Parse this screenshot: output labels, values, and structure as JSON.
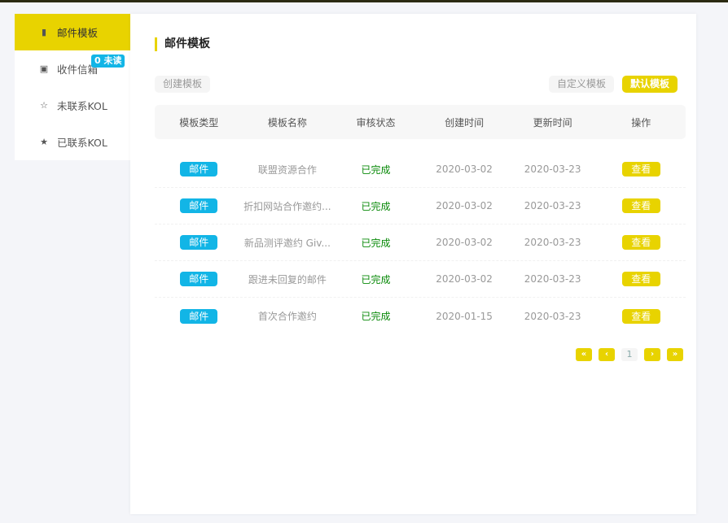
{
  "sidebar": {
    "items": [
      {
        "label": "邮件模板",
        "icon": "file-icon",
        "active": true
      },
      {
        "label": "收件信箱",
        "icon": "inbox-icon",
        "badge": "0 未读"
      },
      {
        "label": "未联系KOL",
        "icon": "star-outline-icon"
      },
      {
        "label": "已联系KOL",
        "icon": "star-filled-icon"
      }
    ]
  },
  "main": {
    "title": "邮件模板",
    "create_button": "创建模板",
    "custom_button": "自定义模板",
    "default_button": "默认模板",
    "columns": [
      "模板类型",
      "模板名称",
      "审核状态",
      "创建时间",
      "更新时间",
      "操作"
    ],
    "rows": [
      {
        "type": "邮件",
        "name": "联盟资源合作",
        "status": "已完成",
        "created": "2020-03-02",
        "updated": "2020-03-23",
        "action": "查看"
      },
      {
        "type": "邮件",
        "name": "折扣网站合作邀约...",
        "status": "已完成",
        "created": "2020-03-02",
        "updated": "2020-03-23",
        "action": "查看"
      },
      {
        "type": "邮件",
        "name": "新品测评邀约 Giv...",
        "status": "已完成",
        "created": "2020-03-02",
        "updated": "2020-03-23",
        "action": "查看"
      },
      {
        "type": "邮件",
        "name": "跟进未回复的邮件",
        "status": "已完成",
        "created": "2020-03-02",
        "updated": "2020-03-23",
        "action": "查看"
      },
      {
        "type": "邮件",
        "name": "首次合作邀约",
        "status": "已完成",
        "created": "2020-01-15",
        "updated": "2020-03-23",
        "action": "查看"
      }
    ],
    "pagination": {
      "first": "«",
      "prev": "‹",
      "page": "1",
      "next": "›",
      "last": "»"
    }
  },
  "colors": {
    "accent": "#e8d300",
    "tag": "#12b5e6",
    "status": "#0a8a0a"
  }
}
